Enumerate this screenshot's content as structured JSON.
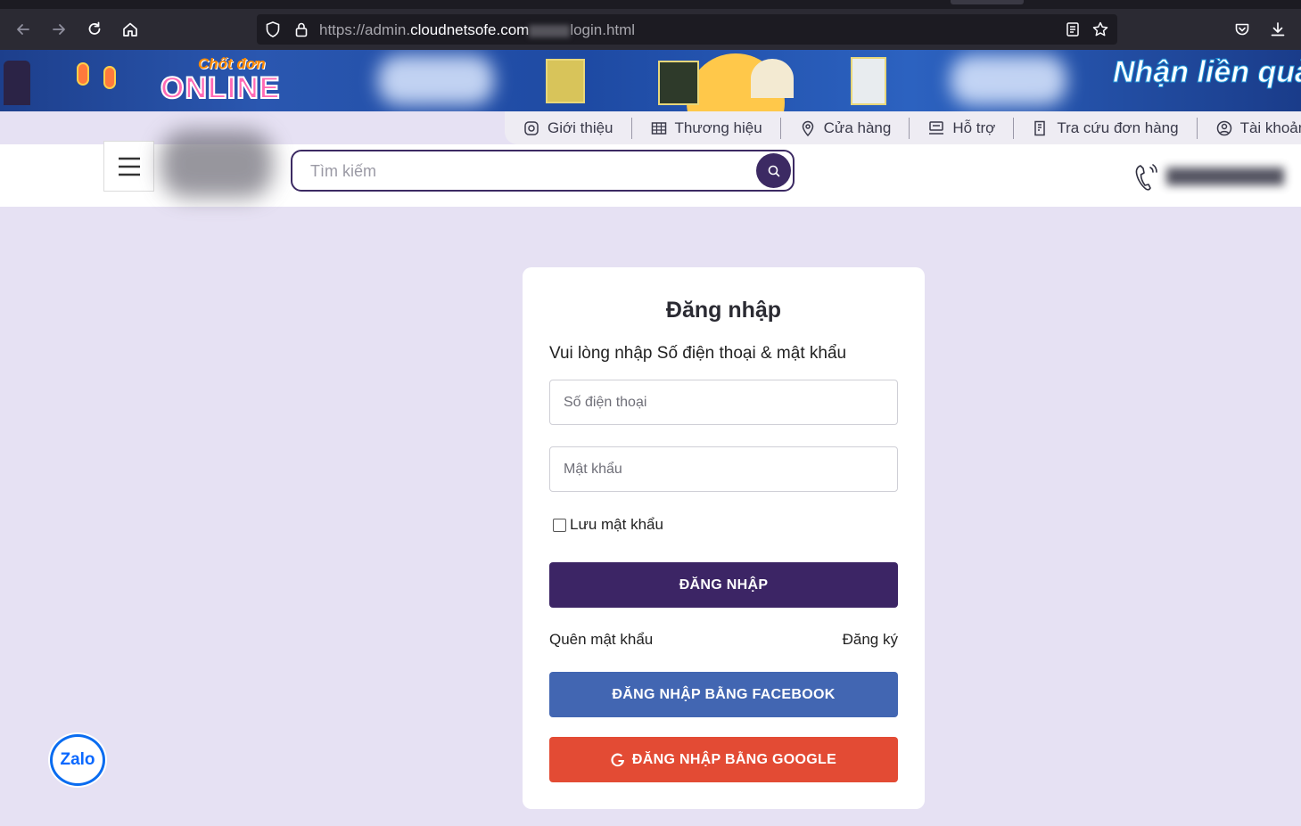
{
  "browser": {
    "url_prefix": "https://admin.",
    "url_domain": "cloudnetsofe.com",
    "url_suffix": "login.html"
  },
  "banner": {
    "promo_left_small": "Chốt đơn",
    "promo_left_big": "ONLINE",
    "promo_right": "Nhận liền quà x"
  },
  "topmenu": {
    "items": [
      {
        "label": "Giới thiệu",
        "icon": "info-icon"
      },
      {
        "label": "Thương hiệu",
        "icon": "grid-icon"
      },
      {
        "label": "Cửa hàng",
        "icon": "location-pin-icon"
      },
      {
        "label": "Hỗ trợ",
        "icon": "support-icon"
      },
      {
        "label": "Tra cứu đơn hàng",
        "icon": "qr-code-icon"
      },
      {
        "label": "Tài khoản",
        "icon": "user-circle-icon"
      }
    ]
  },
  "header": {
    "search_placeholder": "Tìm kiếm"
  },
  "login": {
    "title": "Đăng nhập",
    "subtitle": "Vui lòng nhập Số điện thoại & mật khẩu",
    "phone_placeholder": "Số điện thoại",
    "password_placeholder": "Mật khẩu",
    "remember_label": "Lưu mật khẩu",
    "login_button": "ĐĂNG NHẬP",
    "forgot_link": "Quên mật khẩu",
    "register_link": "Đăng ký",
    "facebook_button": "ĐĂNG NHẬP BẰNG FACEBOOK",
    "google_button": "ĐĂNG NHẬP BẰNG GOOGLE"
  },
  "zalo": {
    "label": "Zalo"
  },
  "colors": {
    "brand": "#3c2565",
    "facebook": "#4266b2",
    "google": "#e34b34",
    "page_bg": "#e6e1f3"
  }
}
